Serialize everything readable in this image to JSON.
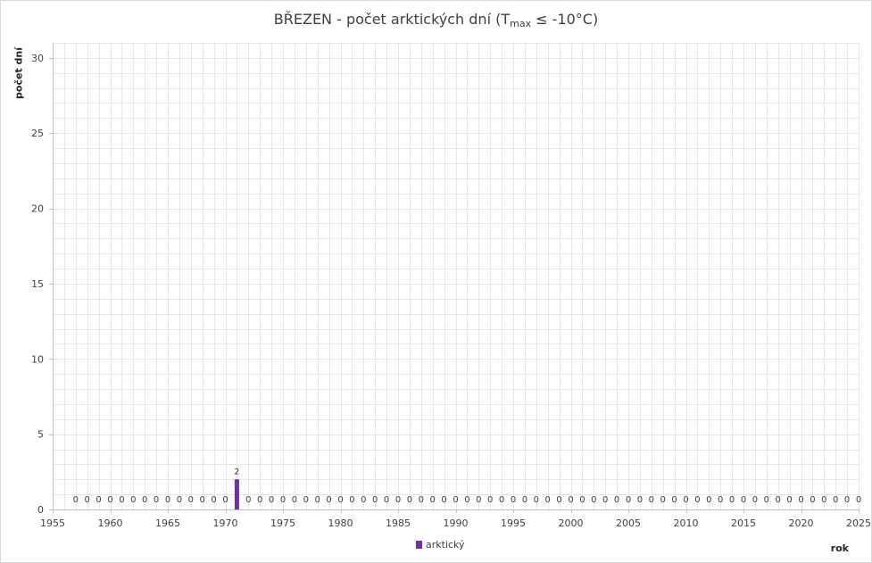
{
  "chart_data": {
    "type": "bar",
    "title": {
      "prefix": "BŘEZEN - počet arktických dní (T",
      "subscript": "max",
      "suffix": " ≤ -10°C)"
    },
    "ylabel": "počet dní",
    "xlabel": "rok",
    "xlim": [
      1955,
      2025
    ],
    "ylim": [
      0,
      31
    ],
    "x_ticks": [
      1955,
      1960,
      1965,
      1970,
      1975,
      1980,
      1985,
      1990,
      1995,
      2000,
      2005,
      2010,
      2015,
      2020,
      2025
    ],
    "y_ticks": [
      0,
      5,
      10,
      15,
      20,
      25,
      30
    ],
    "grid": true,
    "legend_position": "bottom",
    "series": [
      {
        "name": "arktický",
        "color": "#7030a0",
        "points": [
          [
            1957,
            0
          ],
          [
            1958,
            0
          ],
          [
            1959,
            0
          ],
          [
            1960,
            0
          ],
          [
            1961,
            0
          ],
          [
            1962,
            0
          ],
          [
            1963,
            0
          ],
          [
            1964,
            0
          ],
          [
            1965,
            0
          ],
          [
            1966,
            0
          ],
          [
            1967,
            0
          ],
          [
            1968,
            0
          ],
          [
            1969,
            0
          ],
          [
            1970,
            0
          ],
          [
            1971,
            2
          ],
          [
            1972,
            0
          ],
          [
            1973,
            0
          ],
          [
            1974,
            0
          ],
          [
            1975,
            0
          ],
          [
            1976,
            0
          ],
          [
            1977,
            0
          ],
          [
            1978,
            0
          ],
          [
            1979,
            0
          ],
          [
            1980,
            0
          ],
          [
            1981,
            0
          ],
          [
            1982,
            0
          ],
          [
            1983,
            0
          ],
          [
            1984,
            0
          ],
          [
            1985,
            0
          ],
          [
            1986,
            0
          ],
          [
            1987,
            0
          ],
          [
            1988,
            0
          ],
          [
            1989,
            0
          ],
          [
            1990,
            0
          ],
          [
            1991,
            0
          ],
          [
            1992,
            0
          ],
          [
            1993,
            0
          ],
          [
            1994,
            0
          ],
          [
            1995,
            0
          ],
          [
            1996,
            0
          ],
          [
            1997,
            0
          ],
          [
            1998,
            0
          ],
          [
            1999,
            0
          ],
          [
            2000,
            0
          ],
          [
            2001,
            0
          ],
          [
            2002,
            0
          ],
          [
            2003,
            0
          ],
          [
            2004,
            0
          ],
          [
            2005,
            0
          ],
          [
            2006,
            0
          ],
          [
            2007,
            0
          ],
          [
            2008,
            0
          ],
          [
            2009,
            0
          ],
          [
            2010,
            0
          ],
          [
            2011,
            0
          ],
          [
            2012,
            0
          ],
          [
            2013,
            0
          ],
          [
            2014,
            0
          ],
          [
            2015,
            0
          ],
          [
            2016,
            0
          ],
          [
            2017,
            0
          ],
          [
            2018,
            0
          ],
          [
            2019,
            0
          ],
          [
            2020,
            0
          ],
          [
            2021,
            0
          ],
          [
            2022,
            0
          ],
          [
            2023,
            0
          ],
          [
            2024,
            0
          ],
          [
            2025,
            0
          ]
        ]
      }
    ]
  }
}
